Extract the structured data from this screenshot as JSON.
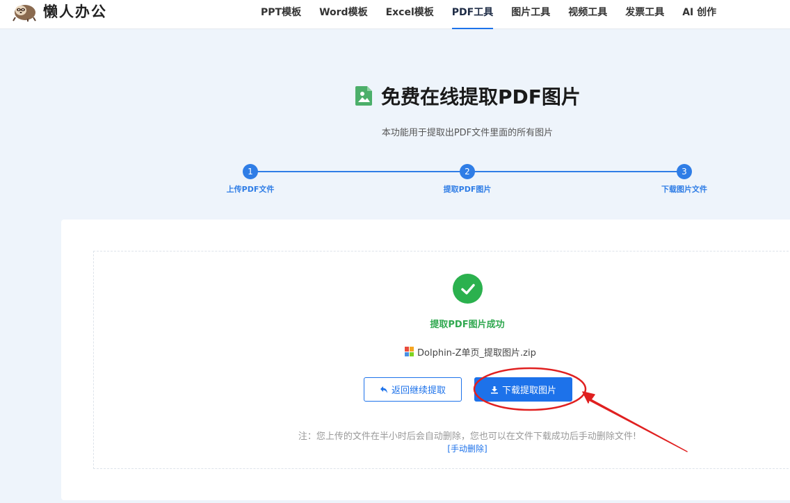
{
  "brand": {
    "name": "懒人办公"
  },
  "nav": {
    "items": [
      {
        "label": "PPT模板",
        "active": false
      },
      {
        "label": "Word模板",
        "active": false
      },
      {
        "label": "Excel模板",
        "active": false
      },
      {
        "label": "PDF工具",
        "active": true
      },
      {
        "label": "图片工具",
        "active": false
      },
      {
        "label": "视频工具",
        "active": false
      },
      {
        "label": "发票工具",
        "active": false
      },
      {
        "label": "AI 创作",
        "active": false
      }
    ]
  },
  "hero": {
    "title": "免费在线提取PDF图片",
    "subtitle": "本功能用于提取出PDF文件里面的所有图片",
    "icon": "image-document-icon"
  },
  "steps": [
    {
      "number": "1",
      "label": "上传PDF文件"
    },
    {
      "number": "2",
      "label": "提取PDF图片"
    },
    {
      "number": "3",
      "label": "下载图片文件"
    }
  ],
  "result": {
    "success_text": "提取PDF图片成功",
    "file_name": "Dolphin-Z单页_提取图片.zip",
    "back_label": "返回继续提取",
    "download_label": "下载提取图片",
    "note": "注：您上传的文件在半小时后会自动删除，您也可以在文件下载成功后手动删除文件!",
    "manual_delete": "[手动删除]"
  },
  "colors": {
    "accent": "#1d72ea",
    "step": "#2f7de6",
    "success": "#2bb14e",
    "annotation": "#e02020",
    "page_bg": "#eef4fb"
  }
}
